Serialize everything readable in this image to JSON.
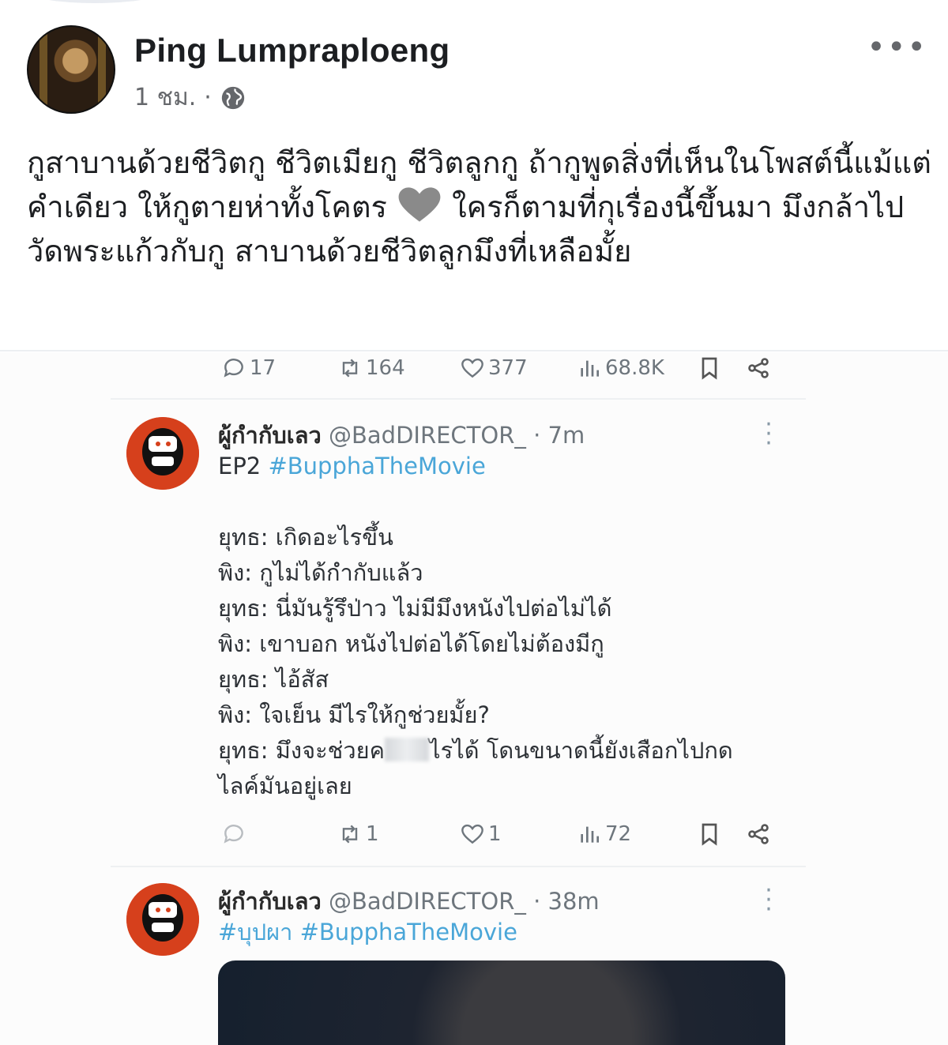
{
  "post": {
    "author": "Ping Lumpraploeng",
    "time": "1 ชม.",
    "dot": "·",
    "text_before_heart": "กูสาบานด้วยชีวิตกู ชีวิตเมียกู ชีวิตลูกกู ถ้ากูพูดสิ่งที่เห็นในโพสต์นี้แม้แต่คำเดียว ให้กูตายห่าทั้งโคตร",
    "text_after_heart": "ใครก็ตามที่กุเรื่องนี้ขึ้นมา มึงกล้าไปวัดพระแก้วกับกู สาบานด้วยชีวิตลูกมึงที่เหลือมั้ย",
    "heart_color": "#8a8a8a"
  },
  "screenshot": {
    "top_actions": {
      "replies": "17",
      "retweets": "164",
      "likes": "377",
      "views": "68.8K"
    },
    "tweets": [
      {
        "display_name": "ผู้กำกับเลว",
        "handle": "@BadDIRECTOR_",
        "time": "7m",
        "first_line": "EP2",
        "hashtags": "#BupphaTheMovie",
        "lines": [
          "ยุทธ: เกิดอะไรขึ้น",
          "พิง: กูไม่ได้กำกับแล้ว",
          "ยุทธ: นี่มันรู้รึป่าว ไม่มีมึงหนังไปต่อไม่ได้",
          "พิง: เขาบอก หนังไปต่อได้โดยไม่ต้องมีกู",
          "ยุทธ: ไอ้สัส",
          "พิง: ใจเย็น มีไรให้กูช่วยมั้ย?"
        ],
        "last_line_before_blur": "ยุทธ: มึงจะช่วยค",
        "last_line_after_blur": "ไรได้ โดนขนาดนี้ยังเสือกไปกด",
        "last_line_wrap": "ไลค์มันอยู่เลย",
        "actions": {
          "replies": "",
          "retweets": "1",
          "likes": "1",
          "views": "72"
        }
      },
      {
        "display_name": "ผู้กำกับเลว",
        "handle": "@BadDIRECTOR_",
        "time": "38m",
        "hashtags": "#บุปผา #BupphaTheMovie"
      }
    ]
  }
}
